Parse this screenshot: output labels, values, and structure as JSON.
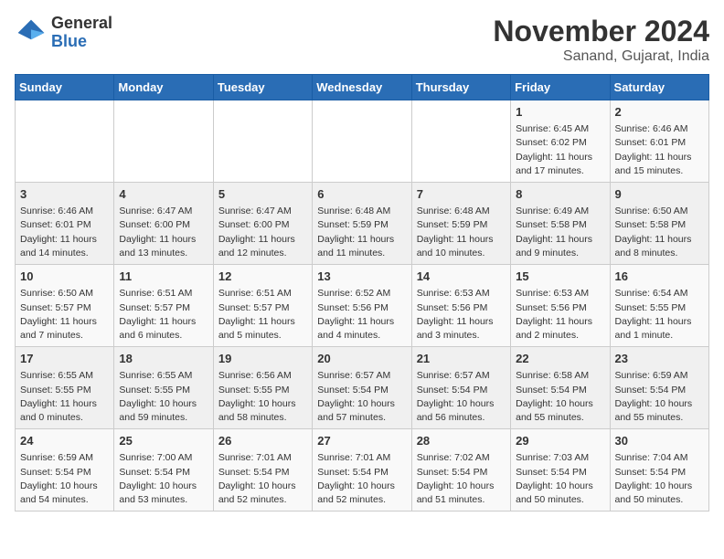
{
  "header": {
    "logo_general": "General",
    "logo_blue": "Blue",
    "title": "November 2024",
    "subtitle": "Sanand, Gujarat, India"
  },
  "weekdays": [
    "Sunday",
    "Monday",
    "Tuesday",
    "Wednesday",
    "Thursday",
    "Friday",
    "Saturday"
  ],
  "weeks": [
    [
      {
        "day": "",
        "info": ""
      },
      {
        "day": "",
        "info": ""
      },
      {
        "day": "",
        "info": ""
      },
      {
        "day": "",
        "info": ""
      },
      {
        "day": "",
        "info": ""
      },
      {
        "day": "1",
        "info": "Sunrise: 6:45 AM\nSunset: 6:02 PM\nDaylight: 11 hours and 17 minutes."
      },
      {
        "day": "2",
        "info": "Sunrise: 6:46 AM\nSunset: 6:01 PM\nDaylight: 11 hours and 15 minutes."
      }
    ],
    [
      {
        "day": "3",
        "info": "Sunrise: 6:46 AM\nSunset: 6:01 PM\nDaylight: 11 hours and 14 minutes."
      },
      {
        "day": "4",
        "info": "Sunrise: 6:47 AM\nSunset: 6:00 PM\nDaylight: 11 hours and 13 minutes."
      },
      {
        "day": "5",
        "info": "Sunrise: 6:47 AM\nSunset: 6:00 PM\nDaylight: 11 hours and 12 minutes."
      },
      {
        "day": "6",
        "info": "Sunrise: 6:48 AM\nSunset: 5:59 PM\nDaylight: 11 hours and 11 minutes."
      },
      {
        "day": "7",
        "info": "Sunrise: 6:48 AM\nSunset: 5:59 PM\nDaylight: 11 hours and 10 minutes."
      },
      {
        "day": "8",
        "info": "Sunrise: 6:49 AM\nSunset: 5:58 PM\nDaylight: 11 hours and 9 minutes."
      },
      {
        "day": "9",
        "info": "Sunrise: 6:50 AM\nSunset: 5:58 PM\nDaylight: 11 hours and 8 minutes."
      }
    ],
    [
      {
        "day": "10",
        "info": "Sunrise: 6:50 AM\nSunset: 5:57 PM\nDaylight: 11 hours and 7 minutes."
      },
      {
        "day": "11",
        "info": "Sunrise: 6:51 AM\nSunset: 5:57 PM\nDaylight: 11 hours and 6 minutes."
      },
      {
        "day": "12",
        "info": "Sunrise: 6:51 AM\nSunset: 5:57 PM\nDaylight: 11 hours and 5 minutes."
      },
      {
        "day": "13",
        "info": "Sunrise: 6:52 AM\nSunset: 5:56 PM\nDaylight: 11 hours and 4 minutes."
      },
      {
        "day": "14",
        "info": "Sunrise: 6:53 AM\nSunset: 5:56 PM\nDaylight: 11 hours and 3 minutes."
      },
      {
        "day": "15",
        "info": "Sunrise: 6:53 AM\nSunset: 5:56 PM\nDaylight: 11 hours and 2 minutes."
      },
      {
        "day": "16",
        "info": "Sunrise: 6:54 AM\nSunset: 5:55 PM\nDaylight: 11 hours and 1 minute."
      }
    ],
    [
      {
        "day": "17",
        "info": "Sunrise: 6:55 AM\nSunset: 5:55 PM\nDaylight: 11 hours and 0 minutes."
      },
      {
        "day": "18",
        "info": "Sunrise: 6:55 AM\nSunset: 5:55 PM\nDaylight: 10 hours and 59 minutes."
      },
      {
        "day": "19",
        "info": "Sunrise: 6:56 AM\nSunset: 5:55 PM\nDaylight: 10 hours and 58 minutes."
      },
      {
        "day": "20",
        "info": "Sunrise: 6:57 AM\nSunset: 5:54 PM\nDaylight: 10 hours and 57 minutes."
      },
      {
        "day": "21",
        "info": "Sunrise: 6:57 AM\nSunset: 5:54 PM\nDaylight: 10 hours and 56 minutes."
      },
      {
        "day": "22",
        "info": "Sunrise: 6:58 AM\nSunset: 5:54 PM\nDaylight: 10 hours and 55 minutes."
      },
      {
        "day": "23",
        "info": "Sunrise: 6:59 AM\nSunset: 5:54 PM\nDaylight: 10 hours and 55 minutes."
      }
    ],
    [
      {
        "day": "24",
        "info": "Sunrise: 6:59 AM\nSunset: 5:54 PM\nDaylight: 10 hours and 54 minutes."
      },
      {
        "day": "25",
        "info": "Sunrise: 7:00 AM\nSunset: 5:54 PM\nDaylight: 10 hours and 53 minutes."
      },
      {
        "day": "26",
        "info": "Sunrise: 7:01 AM\nSunset: 5:54 PM\nDaylight: 10 hours and 52 minutes."
      },
      {
        "day": "27",
        "info": "Sunrise: 7:01 AM\nSunset: 5:54 PM\nDaylight: 10 hours and 52 minutes."
      },
      {
        "day": "28",
        "info": "Sunrise: 7:02 AM\nSunset: 5:54 PM\nDaylight: 10 hours and 51 minutes."
      },
      {
        "day": "29",
        "info": "Sunrise: 7:03 AM\nSunset: 5:54 PM\nDaylight: 10 hours and 50 minutes."
      },
      {
        "day": "30",
        "info": "Sunrise: 7:04 AM\nSunset: 5:54 PM\nDaylight: 10 hours and 50 minutes."
      }
    ]
  ]
}
